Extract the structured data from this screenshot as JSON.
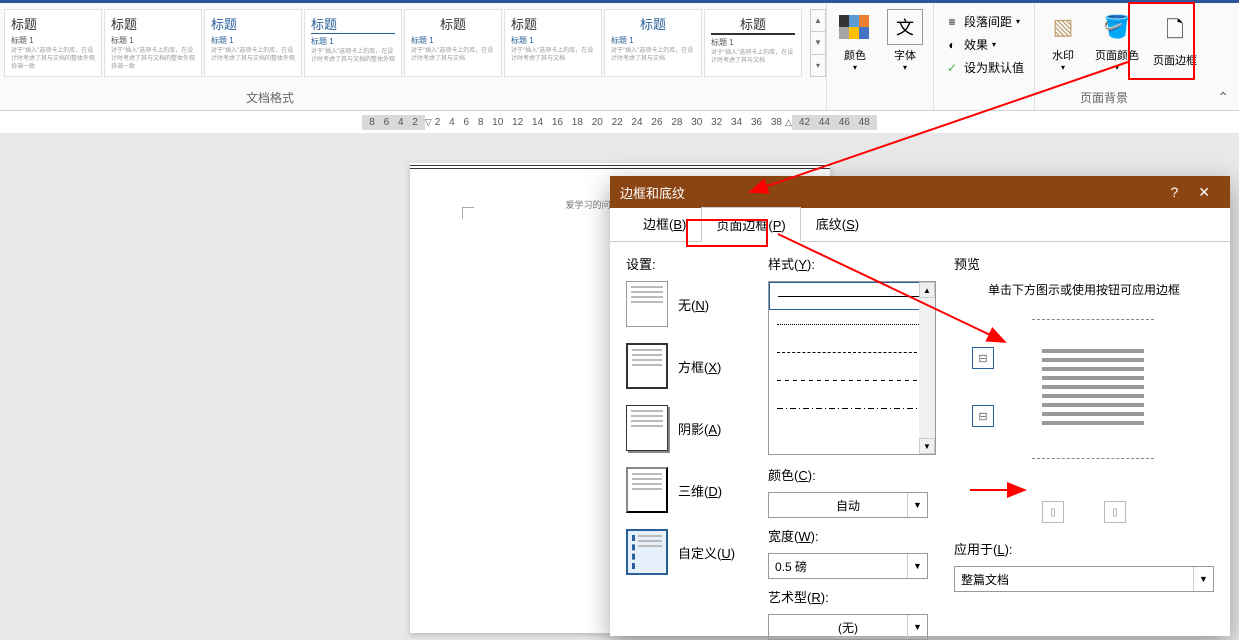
{
  "ribbon": {
    "styles_gallery_title": "标题",
    "styles_gallery_sub": "标题 1",
    "section_label_styles": "文档格式",
    "colors_label": "颜色",
    "fonts_label": "字体",
    "paragraph_spacing": "段落间距",
    "effects": "效果",
    "set_default": "设为默认值",
    "watermark": "水印",
    "page_color": "页面颜色",
    "page_border": "页面边框",
    "section_label_bg": "页面背景"
  },
  "ruler": {
    "marks_left": [
      "8",
      "6",
      "4",
      "2"
    ],
    "marks_main": [
      "2",
      "4",
      "6",
      "8",
      "10",
      "12",
      "14",
      "16",
      "18",
      "20",
      "22",
      "24",
      "26",
      "28",
      "30",
      "32",
      "34",
      "36",
      "38"
    ],
    "marks_right": [
      "42",
      "44",
      "46",
      "48"
    ]
  },
  "page": {
    "sample_text": "爱学习的问白瓦泉页面讲解"
  },
  "dialog": {
    "title": "边框和底纹",
    "tabs": {
      "border": "边框(B)",
      "page_border": "页面边框(P)",
      "shading": "底纹(S)"
    },
    "settings": {
      "label": "设置:",
      "none": "无(N)",
      "box": "方框(X)",
      "shadow": "阴影(A)",
      "threed": "三维(D)",
      "custom": "自定义(U)"
    },
    "style": {
      "label": "样式(Y):",
      "color_label": "颜色(C):",
      "color_value": "自动",
      "width_label": "宽度(W):",
      "width_value": "0.5 磅",
      "art_label": "艺术型(R):",
      "art_value": "(无)"
    },
    "preview": {
      "label": "预览",
      "hint": "单击下方图示或使用按钮可应用边框",
      "apply_label": "应用于(L):",
      "apply_value": "整篇文档"
    }
  }
}
